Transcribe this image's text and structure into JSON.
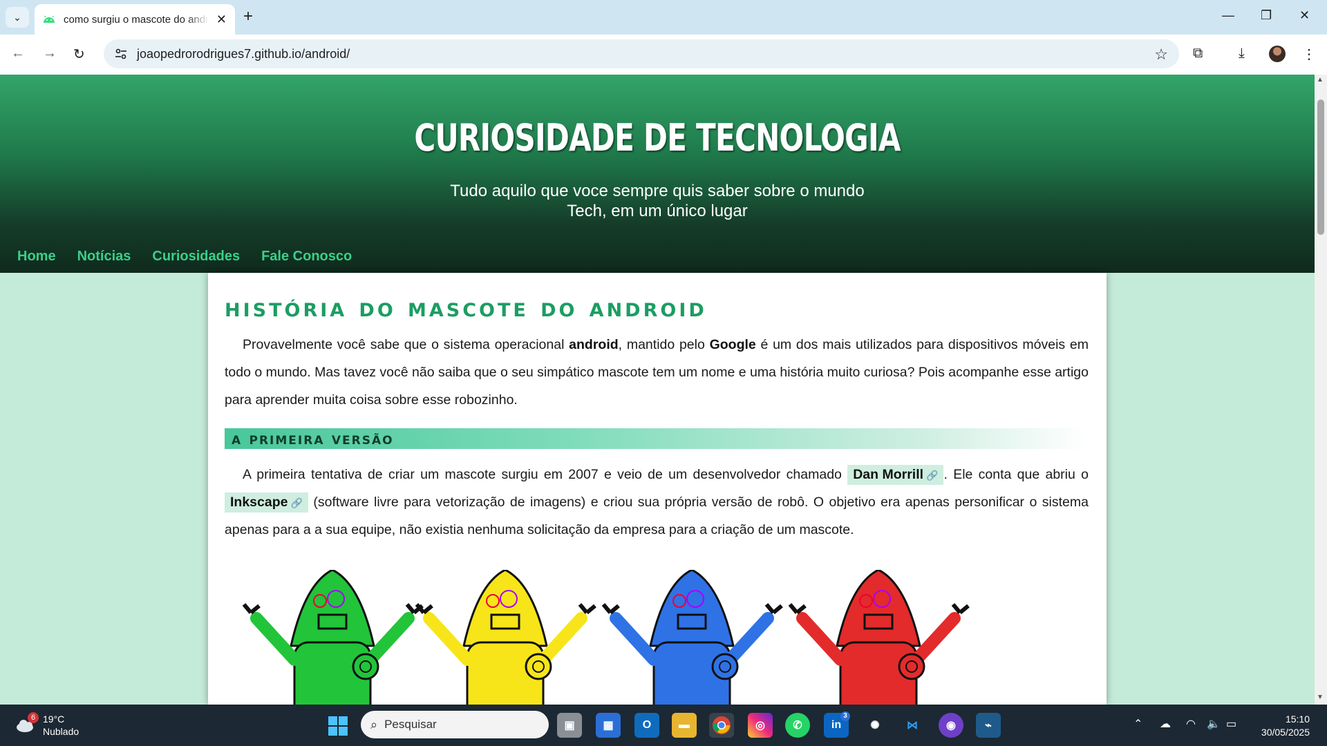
{
  "browser": {
    "tab_title": "como surgiu o mascote do android",
    "tab_close": "✕",
    "new_tab": "+",
    "url": "joaopedrorodrigues7.github.io/android/",
    "window_minimize": "—",
    "window_restore": "❐",
    "window_close": "✕"
  },
  "site": {
    "title": "CURIOSIDADE DE TECNOLOGIA",
    "subtitle_line1": "Tudo aquilo que voce sempre quis saber sobre o mundo",
    "subtitle_line2": "Tech, em um único lugar",
    "nav": [
      "Home",
      "Notícias",
      "Curiosidades",
      "Fale Conosco"
    ]
  },
  "article": {
    "heading": "História do mascote do android",
    "intro": {
      "t1": "Provavelmente você sabe que o sistema operacional ",
      "b1": "android",
      "t2": ", mantido pelo ",
      "b2": "Google",
      "t3": " é um dos mais utilizados para dispositivos móveis em todo o mundo. Mas tavez você não saiba que o seu simpático mascote tem um nome e uma história muito curiosa? Pois acompanhe esse artigo para aprender muita coisa sobre esse robozinho."
    },
    "section_title": "A primeira versão",
    "section_para": {
      "t1": "A primeira tentativa de criar um mascote surgiu em 2007 e veio de um desenvolvedor chamado ",
      "link1": "Dan Morrill",
      "t2": ". Ele conta que abriu o ",
      "link2": "Inkscape",
      "t3": " (software livre para vetorização de imagens) e criou sua própria versão de robô. O objetivo era apenas personificar o sistema apenas para a a sua equipe, não existia nenhuma solicitação da empresa para a criação de um mascote."
    },
    "robot_colors": [
      "#22c43a",
      "#f7e51a",
      "#2f72e6",
      "#e32b2b"
    ]
  },
  "taskbar": {
    "weather_temp": "19°C",
    "weather_desc": "Nublado",
    "weather_badge": "6",
    "search_placeholder": "Pesquisar",
    "linkedin_badge": "3",
    "time": "15:10",
    "date": "30/05/2025"
  }
}
